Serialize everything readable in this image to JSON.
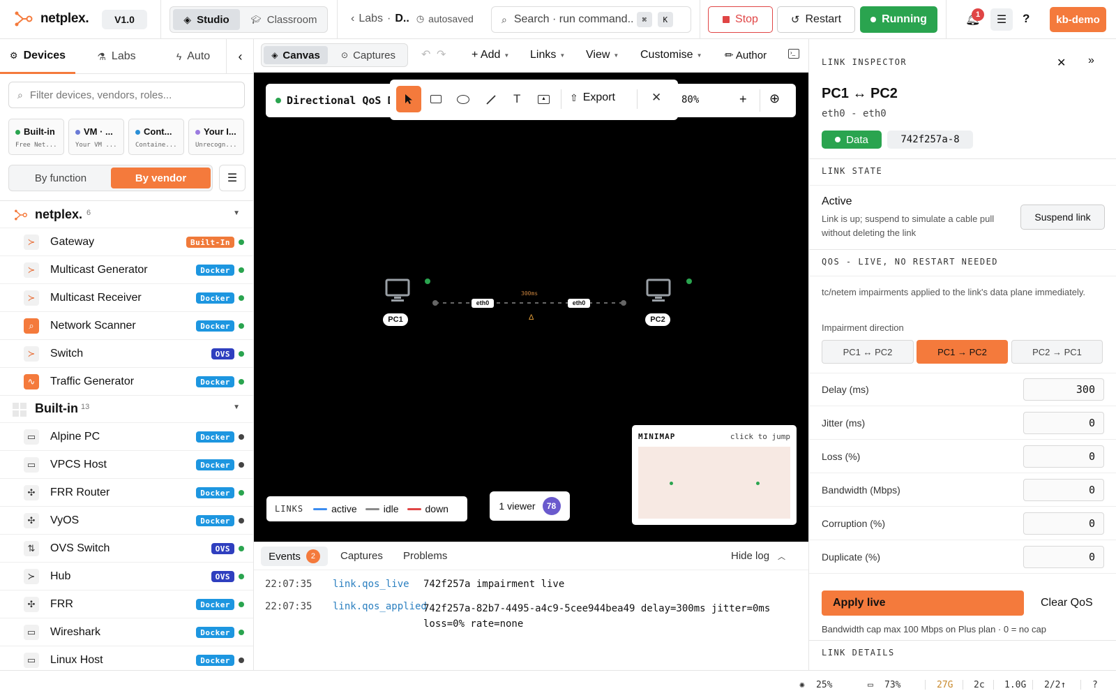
{
  "header": {
    "logo_text": "netplex.",
    "version": "V1.0",
    "modes": [
      "Studio",
      "Classroom"
    ],
    "breadcrumb": {
      "parent": "Labs",
      "sep": "·",
      "current": "D..",
      "autosave": "autosaved"
    },
    "search": {
      "placeholder": "Search · run command...",
      "key1": "⌘",
      "key2": "K"
    },
    "stop_label": "Stop",
    "restart_label": "Restart",
    "running_label": "Running",
    "notification_count": "1",
    "help_label": "?",
    "user_label": "kb-demo"
  },
  "sidebar": {
    "tabs": [
      "Devices",
      "Labs",
      "Auto"
    ],
    "filter_placeholder": "Filter devices, vendors, roles...",
    "chips": [
      {
        "title": "Built-in",
        "sub": "Free Net...",
        "color": "#2aa44f"
      },
      {
        "title": "VM · ...",
        "sub": "Your VM ...",
        "color": "#6b7bd6"
      },
      {
        "title": "Cont...",
        "sub": "Containe...",
        "color": "#2a8fd6"
      },
      {
        "title": "Your I...",
        "sub": "Unrecogn...",
        "color": "#9b7be0"
      }
    ],
    "group_toggle": [
      "By function",
      "By vendor"
    ],
    "groups": [
      {
        "name": "netplex.",
        "count": "6"
      },
      {
        "name": "Built-in",
        "count": "13"
      }
    ],
    "netplex_items": [
      {
        "name": "Gateway",
        "badge": "Built-In",
        "badge_color": "#f07a3a",
        "dot": "#2aa44f"
      },
      {
        "name": "Multicast Generator",
        "badge": "Docker",
        "badge_color": "#1d96e0",
        "dot": "#2aa44f"
      },
      {
        "name": "Multicast Receiver",
        "badge": "Docker",
        "badge_color": "#1d96e0",
        "dot": "#2aa44f"
      },
      {
        "name": "Network Scanner",
        "badge": "Docker",
        "badge_color": "#1d96e0",
        "dot": "#2aa44f"
      },
      {
        "name": "Switch",
        "badge": "OVS",
        "badge_color": "#2f3fbf",
        "dot": "#2aa44f"
      },
      {
        "name": "Traffic Generator",
        "badge": "Docker",
        "badge_color": "#1d96e0",
        "dot": "#2aa44f"
      }
    ],
    "builtin_items": [
      {
        "name": "Alpine PC",
        "badge": "Docker",
        "badge_color": "#1d96e0",
        "dot": "#444"
      },
      {
        "name": "VPCS Host",
        "badge": "Docker",
        "badge_color": "#1d96e0",
        "dot": "#444"
      },
      {
        "name": "FRR Router",
        "badge": "Docker",
        "badge_color": "#1d96e0",
        "dot": "#2aa44f"
      },
      {
        "name": "VyOS",
        "badge": "Docker",
        "badge_color": "#1d96e0",
        "dot": "#444"
      },
      {
        "name": "OVS Switch",
        "badge": "OVS",
        "badge_color": "#2f3fbf",
        "dot": "#2aa44f"
      },
      {
        "name": "Hub",
        "badge": "OVS",
        "badge_color": "#2f3fbf",
        "dot": "#2aa44f"
      },
      {
        "name": "FRR",
        "badge": "Docker",
        "badge_color": "#1d96e0",
        "dot": "#2aa44f"
      },
      {
        "name": "Wireshark",
        "badge": "Docker",
        "badge_color": "#1d96e0",
        "dot": "#2aa44f"
      },
      {
        "name": "Linux Host",
        "badge": "Docker",
        "badge_color": "#1d96e0",
        "dot": "#444"
      }
    ]
  },
  "toolbar": {
    "view_tabs": [
      "Canvas",
      "Captures"
    ],
    "menus": [
      "+ Add",
      "Links",
      "View",
      "Customise"
    ],
    "author_label": "✏ Author"
  },
  "canvas": {
    "lab_title": "Directional QoS D",
    "export_label": "Export",
    "zoom": "80%",
    "zoom_plus": "+",
    "nodes": [
      "PC1",
      "PC2"
    ],
    "link": {
      "if_a": "eth0",
      "if_b": "eth0",
      "delay_label": "300ms",
      "warn": "Δ"
    },
    "legend": {
      "title": "LINKS",
      "items": [
        {
          "label": "active",
          "color": "#3b8cf0"
        },
        {
          "label": "idle",
          "color": "#8a8a8a"
        },
        {
          "label": "down",
          "color": "#e04545"
        }
      ]
    },
    "viewers": {
      "label": "1 viewer",
      "count": "78"
    },
    "minimap": {
      "title": "MINIMAP",
      "hint": "click to jump"
    }
  },
  "log": {
    "tabs": [
      "Events",
      "Captures",
      "Problems"
    ],
    "events_count": "2",
    "hide_label": "Hide log",
    "entries": [
      {
        "time": "22:07:35",
        "type": "link.qos_live",
        "msg": "742f257a impairment live"
      },
      {
        "time": "22:07:35",
        "type": "link.qos_applied",
        "msg": "742f257a-82b7-4495-a4c9-5cee944bea49 delay=300ms jitter=0ms loss=0% rate=none"
      }
    ]
  },
  "inspector": {
    "title": "LINK INSPECTOR",
    "link_name": "PC1 ↔ PC2",
    "interfaces": "eth0 - eth0",
    "type_badge": "Data",
    "id_badge": "742f257a-8",
    "state_section": "LINK STATE",
    "state": "Active",
    "state_desc": "Link is up; suspend to simulate a cable pull without deleting the link",
    "suspend_label": "Suspend link",
    "qos_section": "QOS - LIVE, NO RESTART NEEDED",
    "qos_desc": "tc/netem impairments applied to the link's data plane immediately.",
    "direction_label": "Impairment direction",
    "directions": [
      "PC1 ↔ PC2",
      "PC1 → PC2",
      "PC2 → PC1"
    ],
    "fields": [
      {
        "label": "Delay (ms)",
        "value": "300"
      },
      {
        "label": "Jitter (ms)",
        "value": "0"
      },
      {
        "label": "Loss (%)",
        "value": "0"
      },
      {
        "label": "Bandwidth (Mbps)",
        "value": "0"
      },
      {
        "label": "Corruption (%)",
        "value": "0"
      },
      {
        "label": "Duplicate (%)",
        "value": "0"
      }
    ],
    "apply_label": "Apply live",
    "clear_label": "Clear QoS",
    "note": "Bandwidth cap max 100 Mbps on Plus plan · 0 = no cap",
    "details_section": "LINK DETAILS"
  },
  "statusbar": {
    "cpu": "25%",
    "mem": "73%",
    "disk": "27G",
    "cores": "2c",
    "ram": "1.0G",
    "nodes": "2/2↑",
    "help": "?"
  },
  "colors": {
    "accent": "#f47a3c",
    "running": "#2aa44f",
    "stop": "#e04545"
  }
}
